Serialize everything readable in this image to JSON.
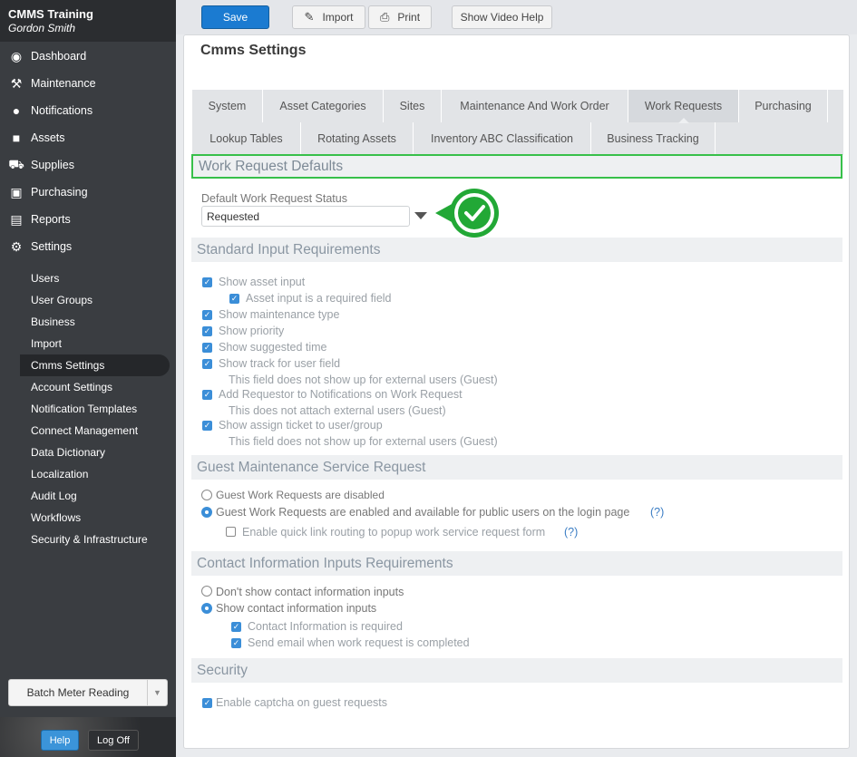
{
  "app": {
    "name": "CMMS Training",
    "user": "Gordon Smith"
  },
  "nav_main": [
    {
      "label": "Dashboard",
      "icon": "dashboard-icon"
    },
    {
      "label": "Maintenance",
      "icon": "tools-icon"
    },
    {
      "label": "Notifications",
      "icon": "chat-bubble-icon"
    },
    {
      "label": "Assets",
      "icon": "box-icon"
    },
    {
      "label": "Supplies",
      "icon": "truck-icon"
    },
    {
      "label": "Purchasing",
      "icon": "cart-icon"
    },
    {
      "label": "Reports",
      "icon": "chart-icon"
    },
    {
      "label": "Settings",
      "icon": "gear-icon"
    }
  ],
  "nav_sub": [
    "Users",
    "User Groups",
    "Business",
    "Import",
    "Cmms Settings",
    "Account Settings",
    "Notification Templates",
    "Connect Management",
    "Data Dictionary",
    "Localization",
    "Audit Log",
    "Workflows",
    "Security & Infrastructure"
  ],
  "nav_sub_active": "Cmms Settings",
  "sidebar_footer": {
    "batch": "Batch Meter Reading",
    "help": "Help",
    "logoff": "Log Off"
  },
  "toolbar": {
    "save": "Save",
    "import": "Import",
    "print": "Print",
    "video": "Show Video Help"
  },
  "page_title": "Cmms Settings",
  "tabs_row1": [
    "System",
    "Asset Categories",
    "Sites",
    "Maintenance And Work Order",
    "Work Requests",
    "Purchasing"
  ],
  "tabs_row2": [
    "Lookup Tables",
    "Rotating Assets",
    "Inventory ABC Classification",
    "Business Tracking"
  ],
  "selected_tab": "Work Requests",
  "sections": {
    "defaults": {
      "title": "Work Request Defaults",
      "status_label": "Default Work Request Status",
      "status_value": "Requested"
    },
    "standard": {
      "title": "Standard Input Requirements",
      "items": [
        "Show asset input",
        "Asset input is a required field",
        "Show maintenance type",
        "Show priority",
        "Show suggested time",
        "Show track for user field",
        "This field does not show up for external users (Guest)",
        "Add Requestor to Notifications on Work Request",
        "This does not attach external users (Guest)",
        "Show assign ticket to user/group",
        "This field does not show up for external users (Guest)"
      ]
    },
    "guest": {
      "title": "Guest Maintenance Service Request",
      "disabled": "Guest Work Requests are disabled",
      "enabled": "Guest Work Requests are enabled and available for public users on the login page",
      "quicklink": "Enable quick link routing to popup work service request form",
      "help": "(?)"
    },
    "contact": {
      "title": "Contact Information Inputs Requirements",
      "dont_show": "Don't show contact information inputs",
      "show": "Show contact information inputs",
      "required": "Contact Information is required",
      "send_email": "Send email when work request is completed"
    },
    "security": {
      "title": "Security",
      "captcha": "Enable captcha on guest requests"
    }
  },
  "colors": {
    "accent": "#3b8ed8",
    "highlight": "#37c04a",
    "sidebar": "#3a3d41"
  }
}
